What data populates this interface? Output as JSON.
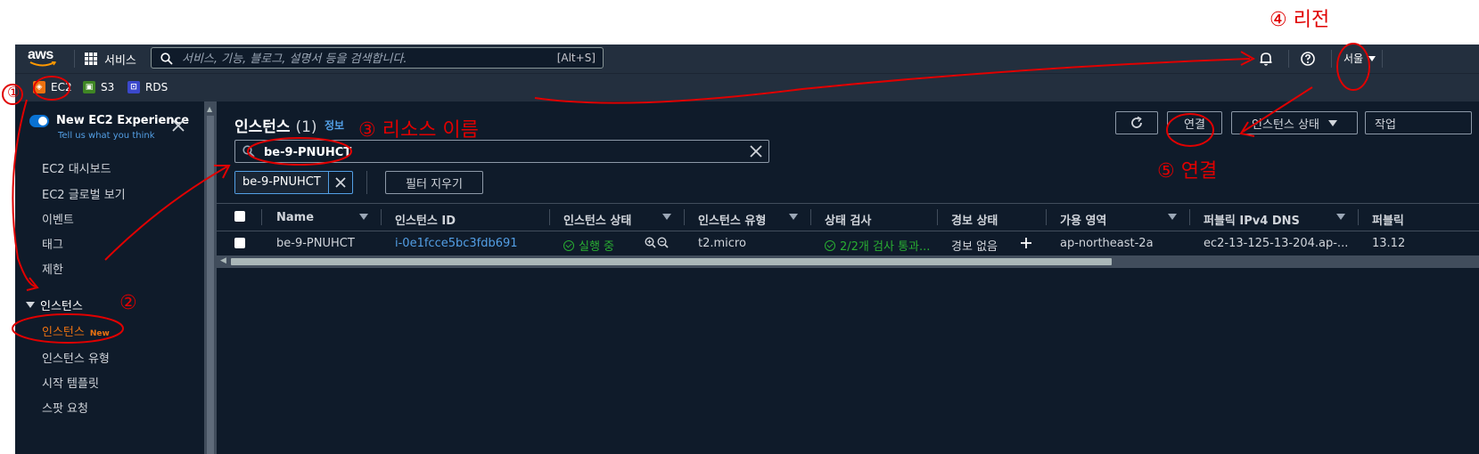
{
  "topnav": {
    "logo": "aws",
    "services_label": "서비스",
    "search_placeholder": "서비스, 기능, 블로그, 설명서 등을 검색합니다.",
    "search_shortcut": "[Alt+S]",
    "region_label": "서울",
    "icons": [
      "grid-icon",
      "search-icon",
      "bell-icon",
      "help-icon",
      "caret-down-icon"
    ]
  },
  "favorites": [
    {
      "label": "EC2",
      "color": "#ec7211"
    },
    {
      "label": "S3",
      "color": "#3f8624"
    },
    {
      "label": "RDS",
      "color": "#3b48cc"
    }
  ],
  "sidebar": {
    "experience_title": "New EC2 Experience",
    "experience_link": "Tell us what you think",
    "items": [
      "EC2 대시보드",
      "EC2 글로벌 보기",
      "이벤트",
      "태그",
      "제한"
    ],
    "section_title": "인스턴스",
    "section_items": [
      "인스턴스",
      "인스턴스 유형",
      "시작 템플릿",
      "스팟 요청"
    ],
    "active_badge": "New"
  },
  "main": {
    "title": "인스턴스",
    "count": "(1)",
    "info_link": "정보",
    "buttons": {
      "connect": "연결",
      "instance_state": "인스턴스 상태",
      "actions": "작업"
    },
    "filter_value": "be-9-PNUHCT",
    "filter_token": "be-9-PNUHCT",
    "clear_filters": "필터 지우기"
  },
  "table": {
    "columns": [
      "Name",
      "인스턴스 ID",
      "인스턴스 상태",
      "인스턴스 유형",
      "상태 검사",
      "경보 상태",
      "가용 영역",
      "퍼블릭 IPv4 DNS",
      "퍼블릭"
    ],
    "rows": [
      {
        "name": "be-9-PNUHCT",
        "instance_id": "i-0e1fcce5bc3fdb691",
        "state": "실행 중",
        "type": "t2.micro",
        "status_check": "2/2개 검사 통과...",
        "alarm": "경보 없음",
        "az": "ap-northeast-2a",
        "dns": "ec2-13-125-13-204.ap-...",
        "public_ip": "13.12"
      }
    ]
  },
  "annotations": {
    "n1": "①",
    "n2": "②",
    "n3": "③ 리소스 이름",
    "n4": "④ 리전",
    "n5": "⑤ 연결",
    "color": "#e00000"
  },
  "colors": {
    "nav_bg": "#232f3e",
    "page_bg": "#0f1b2a",
    "link": "#539fe5",
    "active": "#ec7211",
    "success": "#29ad32"
  }
}
